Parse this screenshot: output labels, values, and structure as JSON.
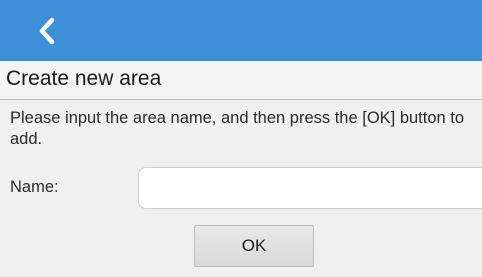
{
  "header": {
    "back_icon": "chevron-left-icon",
    "background_color": "#3d8fd8"
  },
  "page": {
    "title": "Create new area",
    "instructions": "Please input the area name, and then press the [OK] button to add."
  },
  "form": {
    "name_label": "Name:",
    "name_value": "",
    "name_placeholder": ""
  },
  "actions": {
    "ok_label": "OK"
  }
}
